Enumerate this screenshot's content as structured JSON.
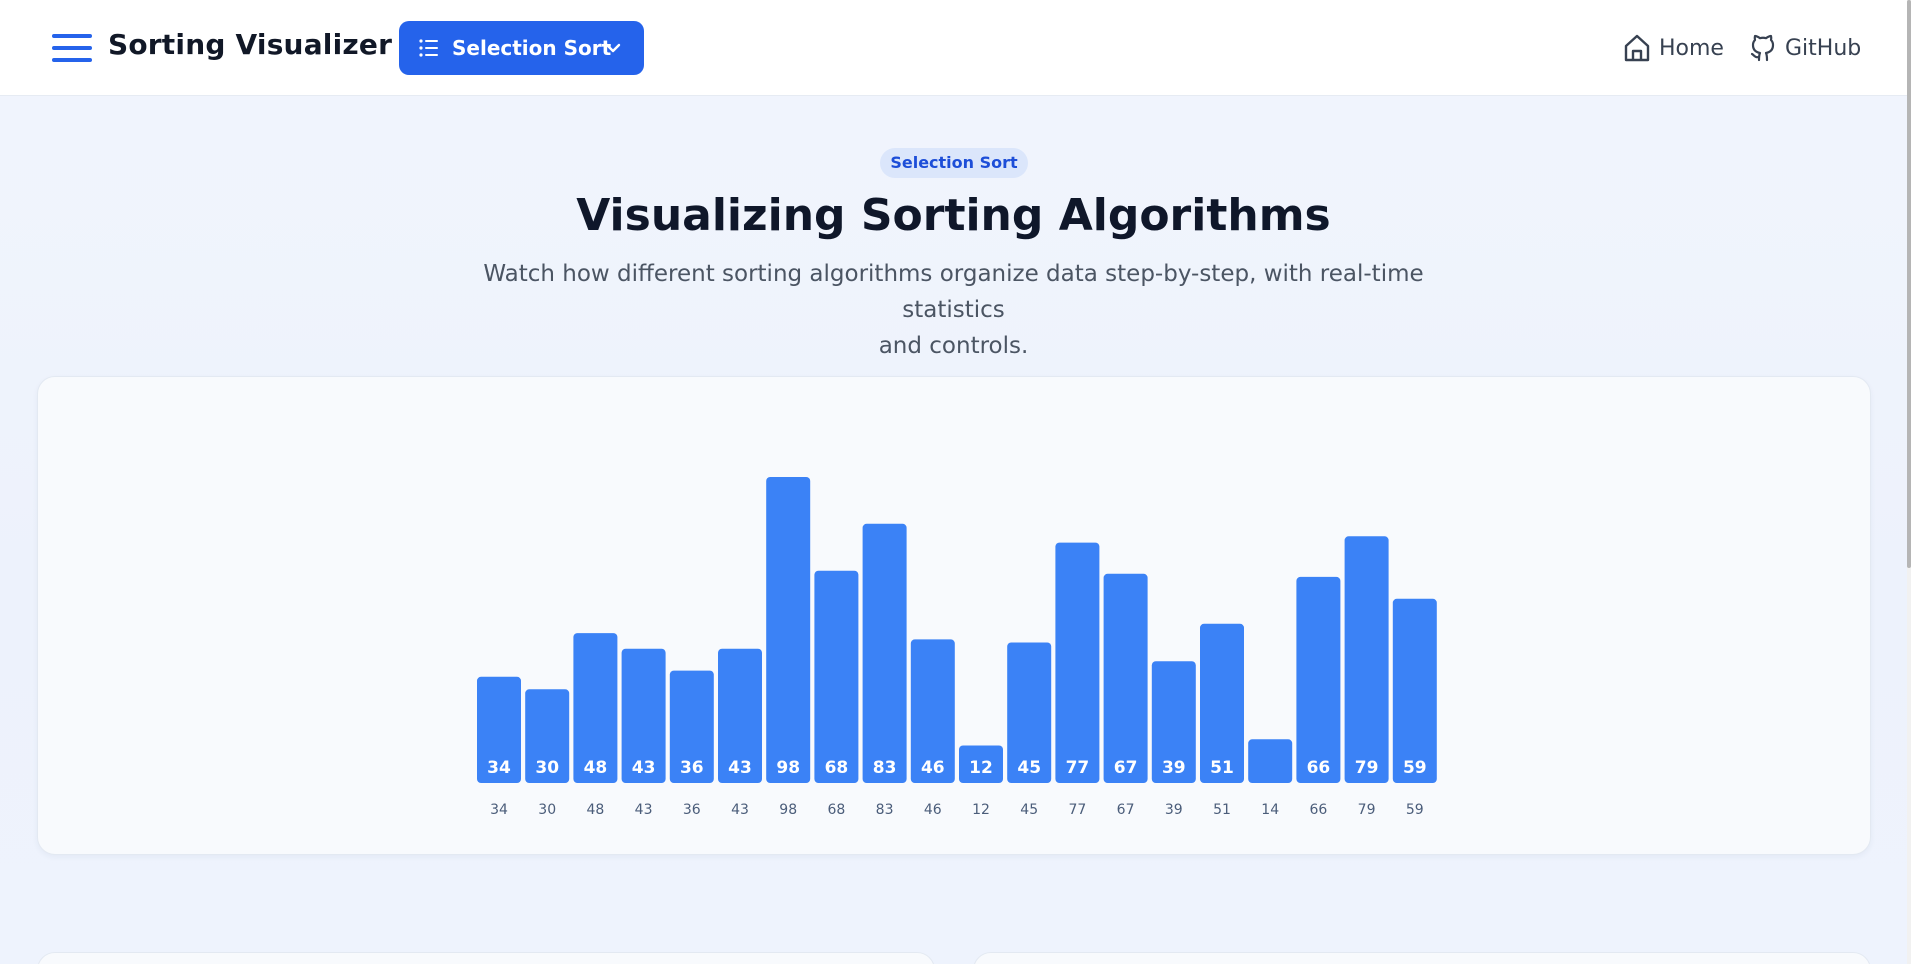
{
  "header": {
    "brand": "Sorting Visualizer",
    "algorithm_select": {
      "label": "Selection Sort"
    },
    "nav": [
      {
        "label": "Home",
        "icon": "home-icon"
      },
      {
        "label": "GitHub",
        "icon": "github-icon"
      }
    ]
  },
  "hero": {
    "badge": "Selection Sort",
    "title": "Visualizing Sorting Algorithms",
    "subtitle_line1": "Watch how different sorting algorithms organize data step-by-step, with real-time statistics",
    "subtitle_line2": "and controls."
  },
  "colors": {
    "accent": "#2563eb",
    "bar": "#3b82f6",
    "bar_label": "#ffffff"
  },
  "chart_data": {
    "type": "bar",
    "categories": [
      "34",
      "30",
      "48",
      "43",
      "36",
      "43",
      "98",
      "68",
      "83",
      "46",
      "12",
      "45",
      "77",
      "67",
      "39",
      "51",
      "14",
      "66",
      "79",
      "59"
    ],
    "values": [
      34,
      30,
      48,
      43,
      36,
      43,
      98,
      68,
      83,
      46,
      12,
      45,
      77,
      67,
      39,
      51,
      14,
      66,
      79,
      59
    ],
    "bar_labels": [
      "34",
      "30",
      "48",
      "43",
      "36",
      "43",
      "98",
      "68",
      "83",
      "46",
      "12",
      "45",
      "77",
      "67",
      "39",
      "51",
      "",
      "66",
      "79",
      "59"
    ],
    "ylim": [
      0,
      98
    ],
    "grid": false
  }
}
